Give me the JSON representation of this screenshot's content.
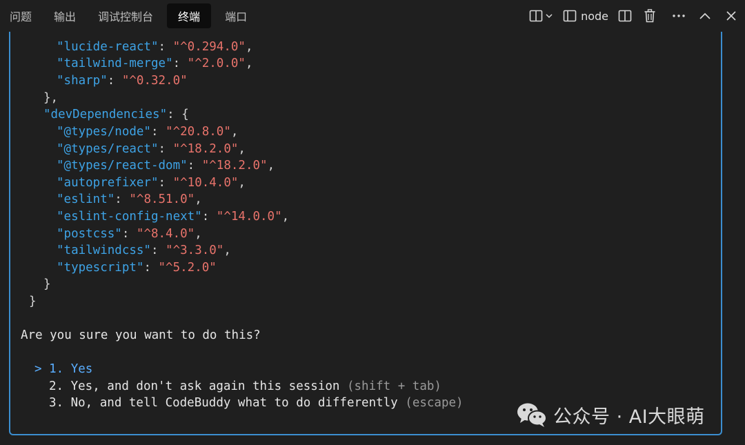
{
  "tabs": [
    {
      "label": "问题",
      "active": false
    },
    {
      "label": "输出",
      "active": false
    },
    {
      "label": "调试控制台",
      "active": false
    },
    {
      "label": "终端",
      "active": true
    },
    {
      "label": "端口",
      "active": false
    }
  ],
  "toolbar": {
    "split_terminal_icon": "split-icon",
    "terminal_name": "node"
  },
  "terminal": {
    "dependencies_tail": [
      {
        "key": "\"lucide-react\"",
        "value": "\"^0.294.0\""
      },
      {
        "key": "\"tailwind-merge\"",
        "value": "\"^2.0.0\""
      },
      {
        "key": "\"sharp\"",
        "value": "\"^0.32.0\""
      }
    ],
    "close_brace_comma": "},",
    "dev_key": "\"devDependencies\"",
    "dev_open": ": {",
    "dev_dependencies": [
      {
        "key": "\"@types/node\"",
        "value": "\"^20.8.0\""
      },
      {
        "key": "\"@types/react\"",
        "value": "\"^18.2.0\""
      },
      {
        "key": "\"@types/react-dom\"",
        "value": "\"^18.2.0\""
      },
      {
        "key": "\"autoprefixer\"",
        "value": "\"^10.4.0\""
      },
      {
        "key": "\"eslint\"",
        "value": "\"^8.51.0\""
      },
      {
        "key": "\"eslint-config-next\"",
        "value": "\"^14.0.0\""
      },
      {
        "key": "\"postcss\"",
        "value": "\"^8.4.0\""
      },
      {
        "key": "\"tailwindcss\"",
        "value": "\"^3.3.0\""
      },
      {
        "key": "\"typescript\"",
        "value": "\"^5.2.0\""
      }
    ],
    "close_inner": "}",
    "close_outer": "}",
    "prompt": "Are you sure you want to do this?",
    "options": [
      {
        "pointer": ">",
        "text": "1. Yes",
        "hint": "",
        "selected": true
      },
      {
        "pointer": "",
        "text": "2. Yes, and don't ask again this session",
        "hint": "(shift + tab)",
        "selected": false
      },
      {
        "pointer": "",
        "text": "3. No, and tell CodeBuddy what to do differently",
        "hint": "(escape)",
        "selected": false
      }
    ]
  },
  "watermark": {
    "text": "公众号 · AI大眼萌",
    "icon": "wechat-icon"
  },
  "colors": {
    "key": "#3ea3e6",
    "value": "#e8736b",
    "accent_border": "#3b8ed0",
    "selected_option": "#5aaeff"
  }
}
